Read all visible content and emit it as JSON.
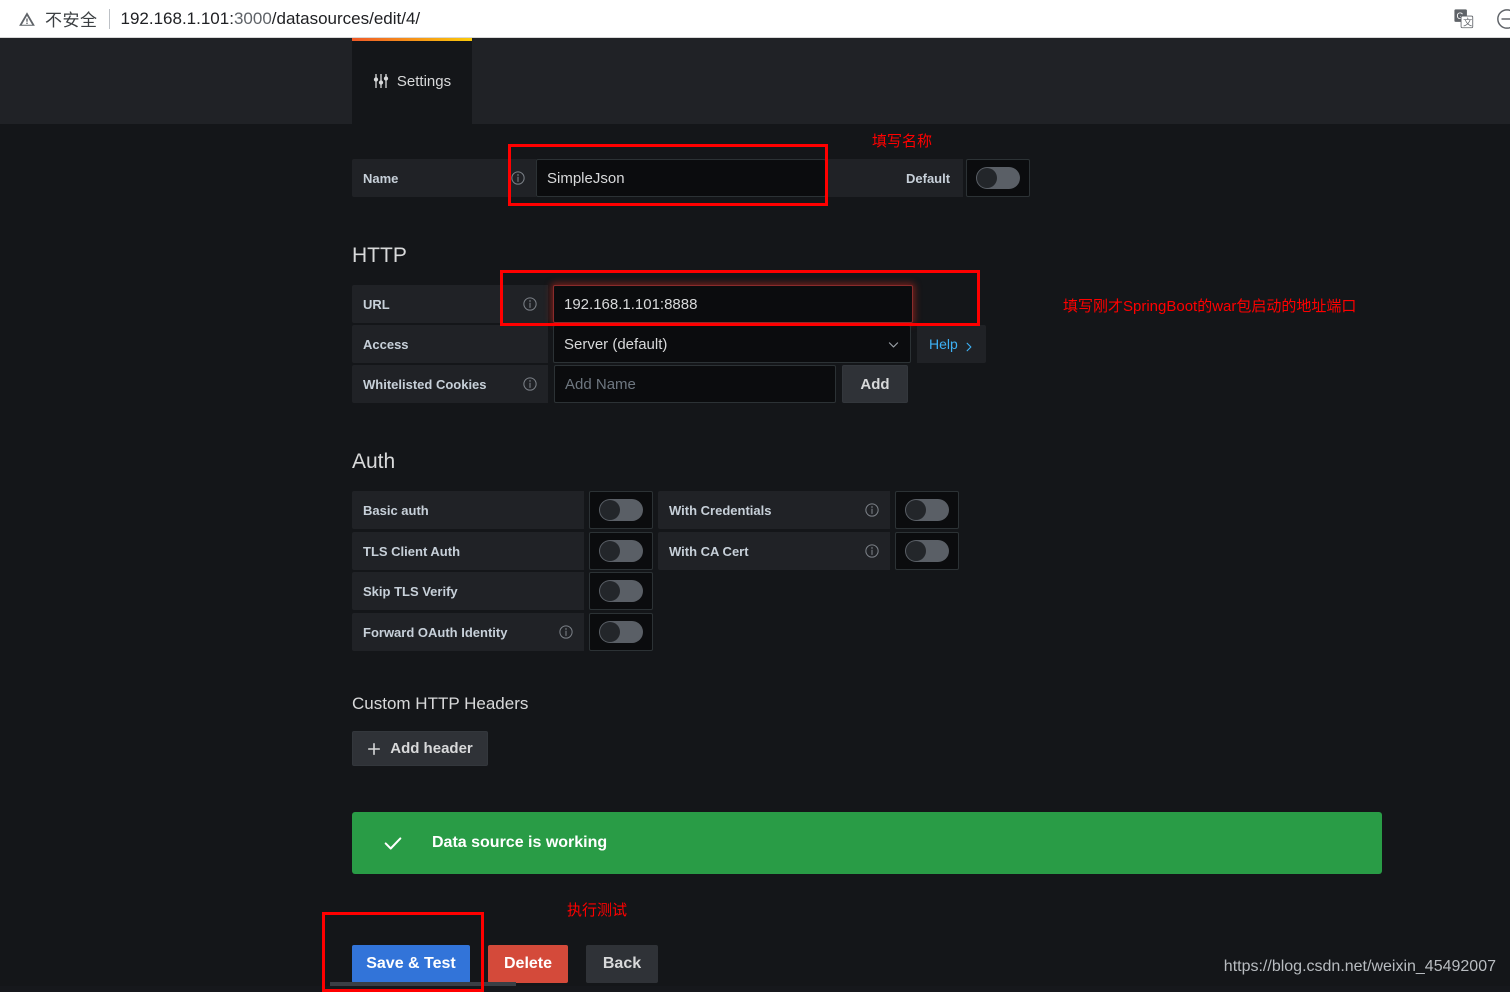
{
  "browser": {
    "insecure_label": "不安全",
    "url": "192.168.1.101:3000/datasources/edit/4/",
    "url_host": "192.168.1.101:",
    "url_port": "3000",
    "url_path": "/datasources/edit/4/",
    "warning_icon": "warning-triangle-icon",
    "translate_icon": "google-translate-icon",
    "profile_icon": "profile-circle-icon"
  },
  "tabs": [
    {
      "label": "Settings",
      "icon": "sliders-icon",
      "active": true
    }
  ],
  "name_row": {
    "label": "Name",
    "value": "SimpleJson",
    "info_icon": "info-circle-icon",
    "default_label": "Default",
    "default_toggle": "off"
  },
  "http": {
    "title": "HTTP",
    "url": {
      "label": "URL",
      "value": "192.168.1.101:8888",
      "info_icon": "info-circle-icon"
    },
    "access": {
      "label": "Access",
      "value": "Server (default)",
      "help_label": "Help",
      "chevron_icon": "chevron-down-icon"
    },
    "cookies": {
      "label": "Whitelisted Cookies",
      "placeholder": "Add Name",
      "value": "",
      "add_label": "Add",
      "info_icon": "info-circle-icon"
    }
  },
  "auth": {
    "title": "Auth",
    "left_items": [
      {
        "label": "Basic auth",
        "toggle": "off",
        "info": false
      },
      {
        "label": "TLS Client Auth",
        "toggle": "off",
        "info": false
      },
      {
        "label": "Skip TLS Verify",
        "toggle": "off",
        "info": false
      },
      {
        "label": "Forward OAuth Identity",
        "toggle": "off",
        "info": true
      }
    ],
    "right_items": [
      {
        "label": "With Credentials",
        "toggle": "off",
        "info": true
      },
      {
        "label": "With CA Cert",
        "toggle": "off",
        "info": true
      }
    ]
  },
  "custom_headers": {
    "title": "Custom HTTP Headers",
    "add_header_label": "Add header",
    "plus_icon": "plus-icon"
  },
  "alert": {
    "text": "Data source is working",
    "icon": "check-icon",
    "color": "#299c46"
  },
  "actions": {
    "save_label": "Save & Test",
    "delete_label": "Delete",
    "back_label": "Back",
    "save_color": "#3274d9",
    "delete_color": "#d44a3a",
    "back_color": "#2f3237"
  },
  "annotations": {
    "color": "#ff0000",
    "name_note": "填写名称",
    "url_note": "填写刚才SpringBoot的war包启动的地址端口",
    "test_note": "执行测试"
  },
  "watermark": "https://blog.csdn.net/weixin_45492007"
}
